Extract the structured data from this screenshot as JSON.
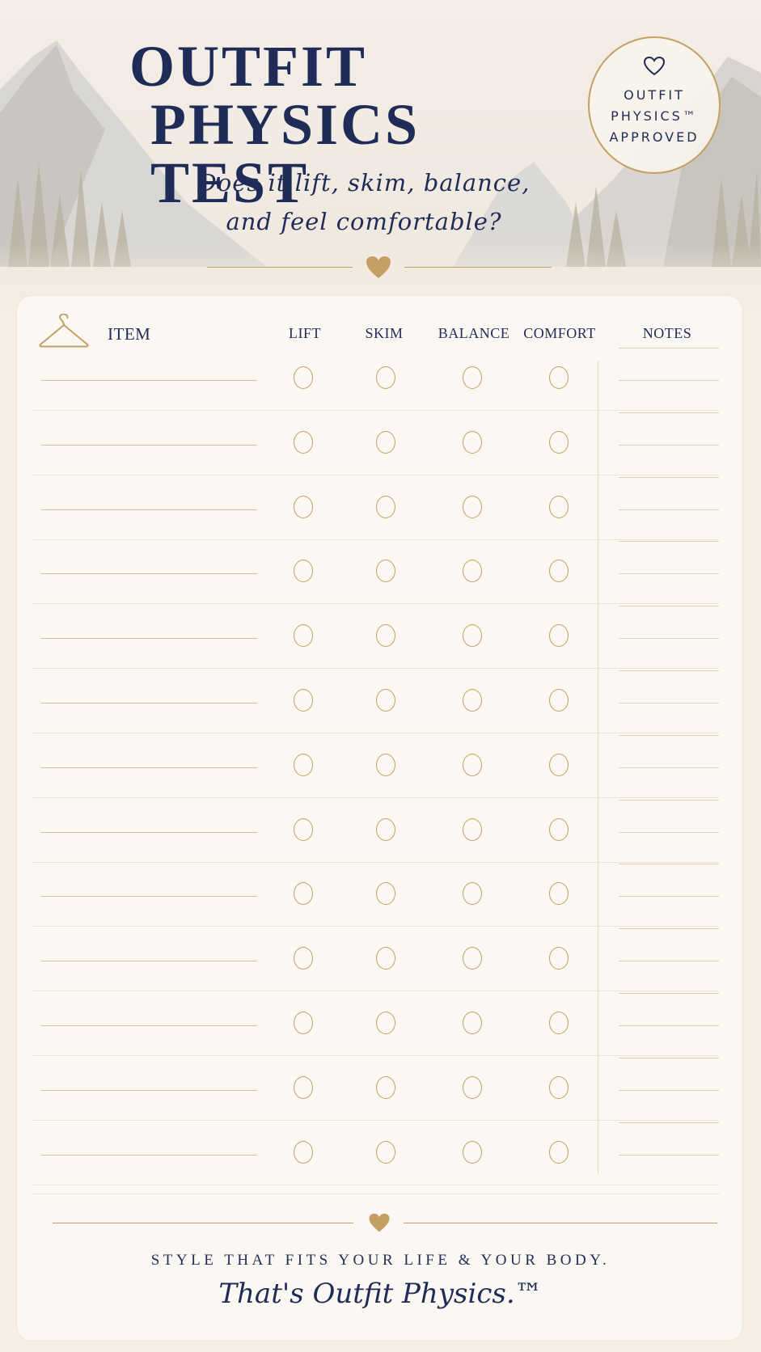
{
  "header": {
    "title_line1": "OUTFIT",
    "title_line2": "PHYSICS TEST",
    "subtitle_line1": "Does it lift, skim, balance,",
    "subtitle_line2": "and feel comfortable?"
  },
  "badge": {
    "icon": "heart-outline-icon",
    "line1": "OUTFIT",
    "line2": "PHYSICS™",
    "line3": "APPROVED"
  },
  "table": {
    "item_header": "ITEM",
    "item_icon": "hanger-icon",
    "columns": [
      "LIFT",
      "SKIM",
      "BALANCE",
      "COMFORT"
    ],
    "notes_header": "NOTES",
    "row_count": 13
  },
  "footer": {
    "tagline": "STYLE THAT FITS YOUR LIFE & YOUR BODY.",
    "signoff": "That's Outfit Physics.™",
    "divider_icon": "heart-icon"
  },
  "colors": {
    "navy": "#1f2c57",
    "gold": "#c49f63",
    "paper": "#fbf7f2"
  }
}
